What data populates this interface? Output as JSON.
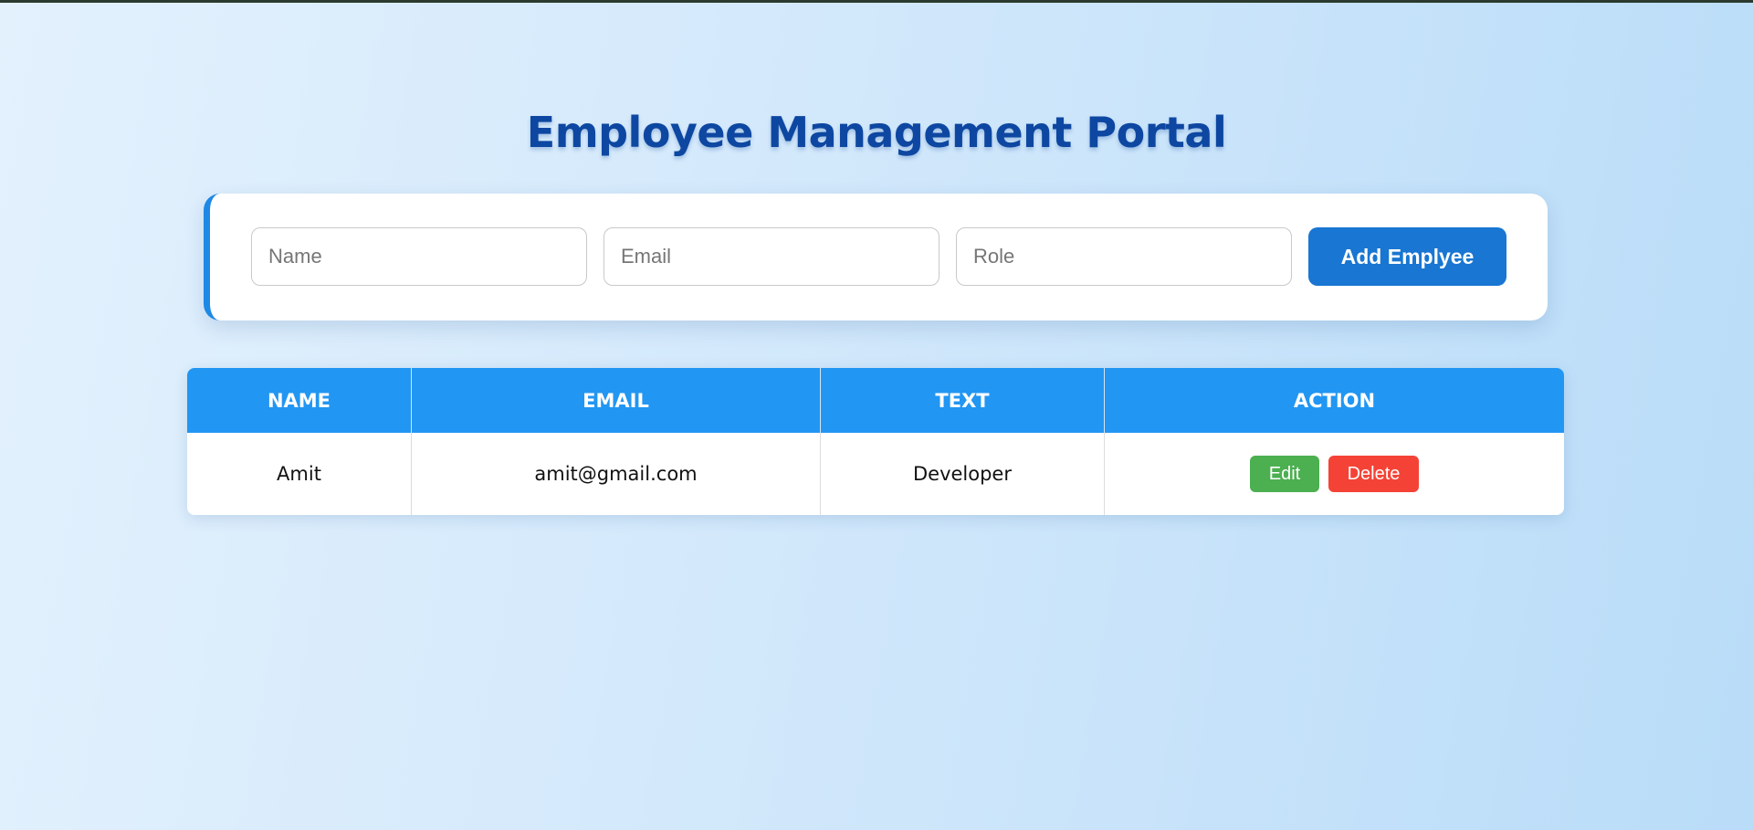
{
  "page": {
    "title": "Employee Management Portal"
  },
  "form": {
    "name_placeholder": "Name",
    "name_value": "",
    "email_placeholder": "Email",
    "email_value": "",
    "role_placeholder": "Role",
    "role_value": "",
    "add_button_label": "Add Emplyee"
  },
  "table": {
    "headers": [
      "NAME",
      "EMAIL",
      "TEXT",
      "ACTION"
    ],
    "rows": [
      {
        "name": "Amit",
        "email": "amit@gmail.com",
        "role": "Developer",
        "edit_label": "Edit",
        "delete_label": "Delete"
      }
    ]
  },
  "colors": {
    "title": "#0d47a1",
    "accent": "#1e88e5",
    "primary_button": "#1976d2",
    "table_header": "#2196f3",
    "edit_button": "#4caf50",
    "delete_button": "#f44336"
  }
}
